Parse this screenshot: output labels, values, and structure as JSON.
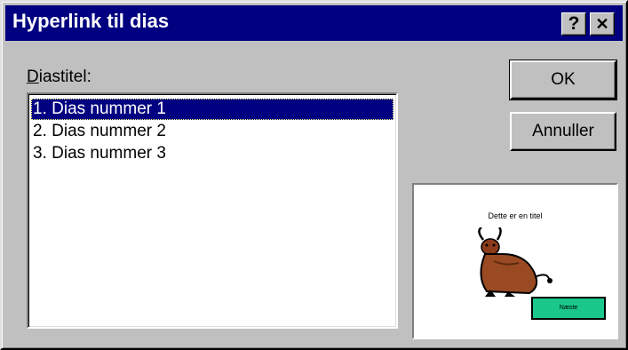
{
  "window": {
    "title": "Hyperlink til dias",
    "help_label": "?",
    "close_label": "✕"
  },
  "form": {
    "label_accesskey": "D",
    "label_rest": "iastitel:"
  },
  "slides": [
    {
      "label": "1. Dias nummer 1",
      "selected": true
    },
    {
      "label": "2. Dias nummer 2",
      "selected": false
    },
    {
      "label": "3. Dias nummer 3",
      "selected": false
    }
  ],
  "buttons": {
    "ok_label": "OK",
    "cancel_label": "Annuller"
  },
  "preview": {
    "slide_title": "Dette er en titel",
    "slide_button": "Næste"
  },
  "colors": {
    "titlebar": "#000080",
    "dialog_face": "#c0c0c0",
    "selection": "#000080",
    "preview_button": "#19c88a"
  },
  "icons": [
    "help-icon",
    "close-icon",
    "bull-clipart"
  ]
}
